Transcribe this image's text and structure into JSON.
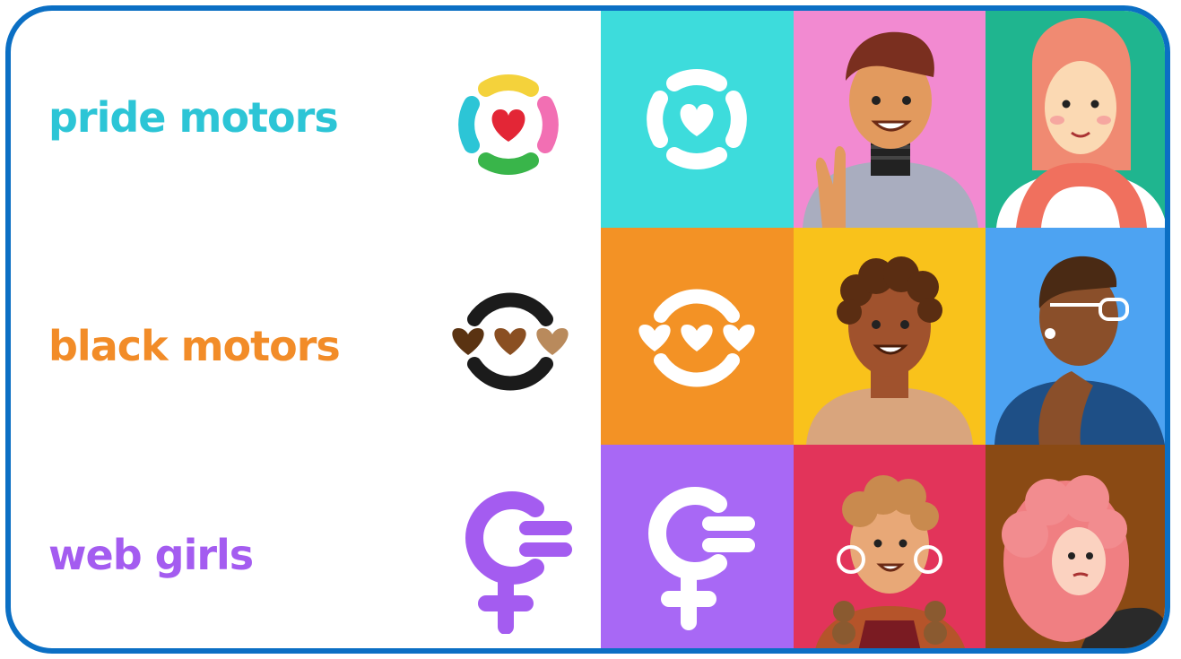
{
  "brands": [
    {
      "name": "pride motors",
      "color": "#2cc5d6",
      "tile_color": "#3ddcdc"
    },
    {
      "name": "black motors",
      "color": "#f28c28",
      "tile_color": "#f39225"
    },
    {
      "name": "web girls",
      "color": "#a45cf0",
      "tile_color": "#a868f5"
    }
  ],
  "colors": {
    "frame_border": "#0b6fc4",
    "pride_logo_segments": [
      "#f4d23b",
      "#f26fb3",
      "#39b54a",
      "#2cc5d6"
    ],
    "pride_heart": "#e32636",
    "black_logo_hearts": [
      "#5a3312",
      "#8a4f22",
      "#b98a5c"
    ],
    "black_logo_ring": "#1b1b1b"
  },
  "portraits": [
    {
      "subject": "person-cap-peace-sign",
      "background": "#f28ad1"
    },
    {
      "subject": "person-pink-hijab",
      "background": "#1fb58f"
    },
    {
      "subject": "person-curly-hair",
      "background": "#f9c21b"
    },
    {
      "subject": "person-glasses-profile",
      "background": "#4da3f2"
    },
    {
      "subject": "person-hoop-earrings",
      "background": "#e2345a"
    },
    {
      "subject": "person-pink-hair",
      "background": "#8a4a14"
    }
  ]
}
